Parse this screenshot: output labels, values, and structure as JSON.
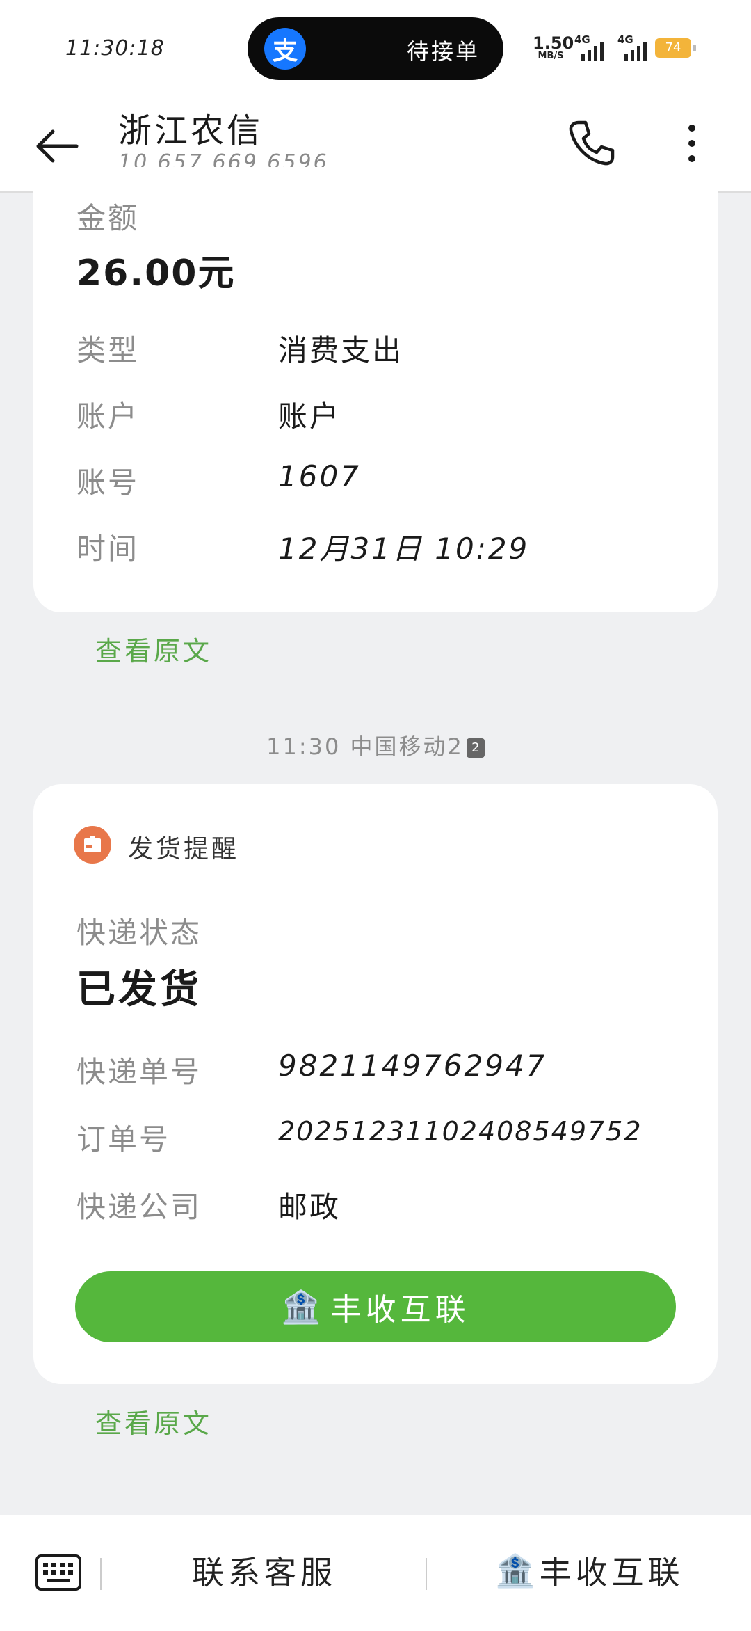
{
  "status_bar": {
    "time": "11:30:18",
    "island_app": "支",
    "island_text": "待接单",
    "net_speed_value": "1.50",
    "net_speed_unit": "MB/S",
    "signal1_label": "4G",
    "signal2_label": "4G",
    "battery": "74"
  },
  "header": {
    "contact_name": "浙江农信",
    "contact_number": "10 657 669 6596"
  },
  "transaction_card": {
    "amount_label": "金额",
    "amount_value": "26.00元",
    "rows": [
      {
        "label": "类型",
        "value": "消费支出"
      },
      {
        "label": "账户",
        "value": "账户"
      },
      {
        "label": "账号",
        "value": "1607"
      },
      {
        "label": "时间",
        "value": "12月31日 10:29"
      }
    ],
    "view_original": "查看原文"
  },
  "message_meta": {
    "time": "11:30",
    "sender": "中国移动2",
    "sim_badge": "2"
  },
  "shipping_card": {
    "title": "发货提醒",
    "status_label": "快递状态",
    "status_value": "已发货",
    "rows": [
      {
        "label": "快递单号",
        "value": "9821149762947"
      },
      {
        "label": "订单号",
        "value": "20251231102408549752"
      },
      {
        "label": "快递公司",
        "value": "邮政"
      }
    ],
    "action_emoji": "🏦",
    "action_label": "丰收互联",
    "view_original": "查看原文"
  },
  "bottom_bar": {
    "menu1_label": "联系客服",
    "menu2_emoji": "🏦",
    "menu2_label": "丰收互联"
  },
  "colors": {
    "accent_green": "#55b73c",
    "link_green": "#5aa84a",
    "alipay_blue": "#1677ff",
    "shipping_icon": "#e8774a",
    "battery": "#f3b43a"
  }
}
